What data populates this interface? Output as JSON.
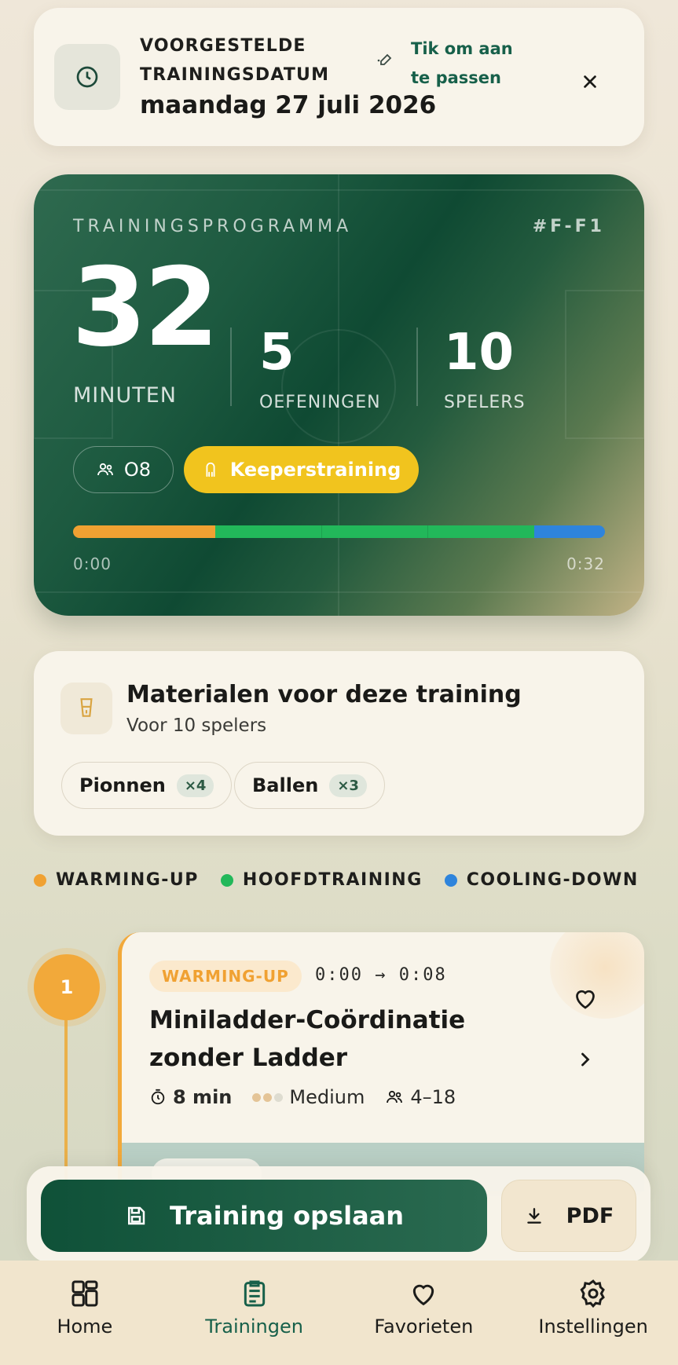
{
  "date_card": {
    "label": "VOORGESTELDE TRAININGSDATUM",
    "value": "maandag 27 juli 2026",
    "edit_hint": "Tik om aan te passen"
  },
  "program": {
    "label": "TRAININGSPROGRAMMA",
    "code": "#F-F1",
    "minutes_value": "32",
    "minutes_label": "MINUTEN",
    "exercises_value": "5",
    "exercises_label": "OEFENINGEN",
    "players_value": "10",
    "players_label": "SPELERS",
    "age_group": "O8",
    "tag": "Keeperstraining",
    "timeline": {
      "start": "0:00",
      "end": "0:32",
      "segments": [
        {
          "phase": "warming-up",
          "minutes": 8,
          "color": "#f0a132"
        },
        {
          "phase": "hoofdtraining",
          "minutes": 6,
          "color": "#22b85a"
        },
        {
          "phase": "hoofdtraining",
          "minutes": 6,
          "color": "#22b85a"
        },
        {
          "phase": "hoofdtraining",
          "minutes": 6,
          "color": "#22b85a"
        },
        {
          "phase": "cooling-down",
          "minutes": 4,
          "color": "#2e84dc"
        }
      ]
    }
  },
  "materials": {
    "title": "Materialen voor deze training",
    "subtitle": "Voor 10 spelers",
    "items": [
      {
        "name": "Pionnen",
        "qty": "×4"
      },
      {
        "name": "Ballen",
        "qty": "×3"
      }
    ]
  },
  "legend": [
    {
      "label": "WARMING-UP",
      "color": "#f0a132"
    },
    {
      "label": "HOOFDTRAINING",
      "color": "#22b85a"
    },
    {
      "label": "COOLING-DOWN",
      "color": "#2e84dc"
    }
  ],
  "exercise": {
    "number": "1",
    "phase": "WARMING-UP",
    "time_start": "0:00",
    "time_end": "0:08",
    "title": "Miniladder-Coördinatie zonder Ladder",
    "duration": "8 min",
    "difficulty": "Medium",
    "players": "4–18"
  },
  "actions": {
    "save_label": "Training opslaan",
    "pdf_label": "PDF"
  },
  "nav": [
    {
      "label": "Home"
    },
    {
      "label": "Trainingen"
    },
    {
      "label": "Favorieten"
    },
    {
      "label": "Instellingen"
    }
  ],
  "colors": {
    "accent": "#17604a",
    "warmup": "#f0a132",
    "main": "#22b85a",
    "cooldown": "#2e84dc",
    "keeper": "#f1c41e"
  }
}
